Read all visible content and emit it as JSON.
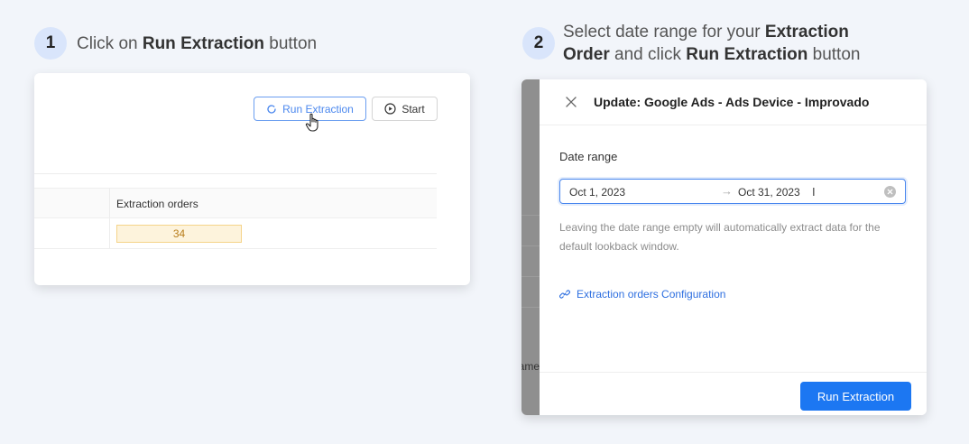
{
  "step1": {
    "number": "1",
    "text_pre": "Click on ",
    "text_bold": "Run Extraction",
    "text_post": " button"
  },
  "step2": {
    "number": "2",
    "line1_pre": "Select date range for your ",
    "line1_bold": "Extraction",
    "line2_bold1": "Order",
    "line2_mid": " and click ",
    "line2_bold2": "Run Extraction",
    "line2_post": " button"
  },
  "card1": {
    "run_button_label": "Run Extraction",
    "start_button_label": "Start",
    "column_header": "Extraction orders",
    "cell_value": "34"
  },
  "drawer": {
    "title": "Update: Google Ads - Ads Device - Improvado",
    "date_range_label": "Date range",
    "date_start": "Oct 1, 2023",
    "date_arrow": "→",
    "date_end": "Oct 31, 2023",
    "help_text": "Leaving the date range empty will automatically extract data for the default lookback window.",
    "config_link": "Extraction orders Configuration",
    "primary_button": "Run Extraction",
    "background_fragment": "ame"
  },
  "colors": {
    "accent": "#1c77f2",
    "badge_bg": "#d9e5fb",
    "cell_badge_bg": "#fdf3dc",
    "cell_badge_text": "#b87d1a"
  }
}
